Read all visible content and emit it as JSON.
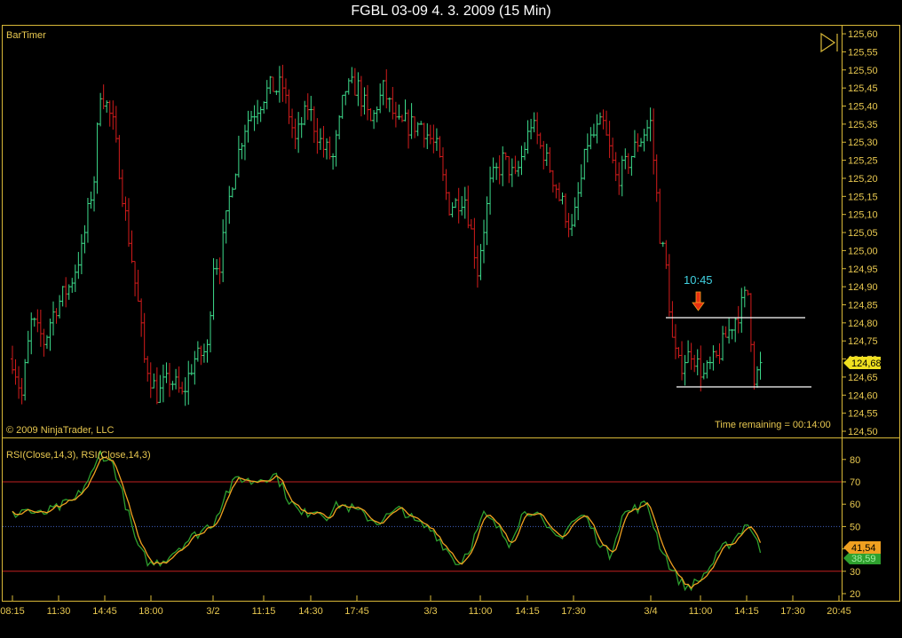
{
  "title": "FGBL 03-09  4. 3. 2009 (15 Min)",
  "colors": {
    "up": "#3ddc8c",
    "down": "#d41c1c",
    "frame": "#d8b838",
    "rsi": "#2ea02e",
    "rsi_avg": "#f0a020",
    "text": "#e8c850"
  },
  "price_panel": {
    "indicator_label": "BarTimer",
    "copyright": "© 2009 NinjaTrader, LLC",
    "time_remaining": "Time remaining = 00:14:00",
    "annotation_time": "10:45",
    "last_price": "124,68",
    "range_high": 124.81,
    "range_low": 124.62
  },
  "rsi_panel": {
    "label": "RSI(Close,14,3), RSI(Close,14,3)",
    "rsi_value": "38,59",
    "avg_value": "41,54"
  },
  "chart_data": [
    {
      "type": "ohlc",
      "title": "FGBL 03-09 (15 Min)",
      "ylim": [
        124.5,
        125.6
      ],
      "ytick_labels": [
        "124,50",
        "124,55",
        "124,60",
        "124,65",
        "124,70",
        "124,75",
        "124,80",
        "124,85",
        "124,90",
        "124,95",
        "125,00",
        "125,05",
        "125,10",
        "125,15",
        "125,20",
        "125,25",
        "125,30",
        "125,35",
        "125,40",
        "125,45",
        "125,50",
        "125,55",
        "125,60"
      ],
      "bar_count": 239,
      "close_keypoints": [
        [
          0,
          124.7
        ],
        [
          3,
          124.6
        ],
        [
          6,
          124.8
        ],
        [
          10,
          124.75
        ],
        [
          14,
          124.85
        ],
        [
          18,
          124.9
        ],
        [
          22,
          125.0
        ],
        [
          26,
          125.2
        ],
        [
          28,
          125.45
        ],
        [
          32,
          125.35
        ],
        [
          36,
          125.1
        ],
        [
          40,
          124.85
        ],
        [
          42,
          124.7
        ],
        [
          46,
          124.6
        ],
        [
          50,
          124.65
        ],
        [
          54,
          124.6
        ],
        [
          58,
          124.7
        ],
        [
          62,
          124.72
        ],
        [
          64,
          124.97
        ],
        [
          66,
          124.97
        ],
        [
          70,
          125.2
        ],
        [
          74,
          125.35
        ],
        [
          78,
          125.4
        ],
        [
          82,
          125.45
        ],
        [
          86,
          125.45
        ],
        [
          90,
          125.3
        ],
        [
          94,
          125.4
        ],
        [
          98,
          125.3
        ],
        [
          102,
          125.25
        ],
        [
          106,
          125.45
        ],
        [
          110,
          125.45
        ],
        [
          114,
          125.35
        ],
        [
          118,
          125.45
        ],
        [
          122,
          125.35
        ],
        [
          130,
          125.35
        ],
        [
          135,
          125.28
        ],
        [
          139,
          125.12
        ],
        [
          144,
          125.15
        ],
        [
          148,
          124.95
        ],
        [
          152,
          125.18
        ],
        [
          156,
          125.25
        ],
        [
          160,
          125.2
        ],
        [
          165,
          125.35
        ],
        [
          170,
          125.25
        ],
        [
          174,
          125.15
        ],
        [
          178,
          125.05
        ],
        [
          183,
          125.3
        ],
        [
          188,
          125.35
        ],
        [
          192,
          125.2
        ],
        [
          196,
          125.25
        ],
        [
          199,
          125.3
        ],
        [
          203,
          125.35
        ],
        [
          206,
          125.05
        ],
        [
          208,
          124.95
        ],
        [
          210,
          124.75
        ],
        [
          212,
          124.68
        ],
        [
          216,
          124.72
        ],
        [
          220,
          124.65
        ],
        [
          224,
          124.7
        ],
        [
          228,
          124.78
        ],
        [
          232,
          124.85
        ],
        [
          234,
          124.88
        ],
        [
          236,
          124.65
        ],
        [
          238,
          124.68
        ]
      ]
    },
    {
      "type": "line",
      "title": "RSI(Close,14,3)",
      "ylim": [
        20,
        85
      ],
      "ytick_labels": [
        "20",
        "30",
        "40",
        "50",
        "60",
        "70",
        "80"
      ],
      "levels": [
        30,
        50,
        70
      ],
      "series": [
        {
          "name": "RSI",
          "keypoints": [
            [
              0,
              55
            ],
            [
              4,
              58
            ],
            [
              8,
              55
            ],
            [
              14,
              58
            ],
            [
              20,
              62
            ],
            [
              26,
              75
            ],
            [
              28,
              83
            ],
            [
              32,
              78
            ],
            [
              36,
              60
            ],
            [
              40,
              40
            ],
            [
              44,
              33
            ],
            [
              48,
              35
            ],
            [
              54,
              42
            ],
            [
              60,
              48
            ],
            [
              64,
              52
            ],
            [
              68,
              65
            ],
            [
              72,
              72
            ],
            [
              76,
              70
            ],
            [
              80,
              72
            ],
            [
              84,
              73
            ],
            [
              88,
              62
            ],
            [
              92,
              55
            ],
            [
              96,
              58
            ],
            [
              100,
              55
            ],
            [
              104,
              60
            ],
            [
              108,
              58
            ],
            [
              112,
              55
            ],
            [
              116,
              52
            ],
            [
              120,
              55
            ],
            [
              124,
              58
            ],
            [
              128,
              52
            ],
            [
              134,
              48
            ],
            [
              138,
              40
            ],
            [
              142,
              33
            ],
            [
              146,
              42
            ],
            [
              150,
              55
            ],
            [
              154,
              50
            ],
            [
              158,
              43
            ],
            [
              162,
              55
            ],
            [
              166,
              58
            ],
            [
              170,
              48
            ],
            [
              174,
              45
            ],
            [
              178,
              52
            ],
            [
              182,
              55
            ],
            [
              186,
              45
            ],
            [
              190,
              37
            ],
            [
              194,
              55
            ],
            [
              198,
              58
            ],
            [
              202,
              60
            ],
            [
              206,
              42
            ],
            [
              210,
              30
            ],
            [
              214,
              23
            ],
            [
              218,
              25
            ],
            [
              222,
              32
            ],
            [
              226,
              40
            ],
            [
              230,
              45
            ],
            [
              234,
              52
            ],
            [
              238,
              39
            ]
          ]
        }
      ]
    }
  ],
  "x_axis": {
    "labels": [
      "08:15",
      "11:30",
      "14:45",
      "18:00",
      "3/2",
      "11:15",
      "14:30",
      "17:45",
      "3/3",
      "11:00",
      "14:15",
      "17:30",
      "3/4",
      "11:00",
      "14:15",
      "17:30",
      "20:45"
    ]
  }
}
